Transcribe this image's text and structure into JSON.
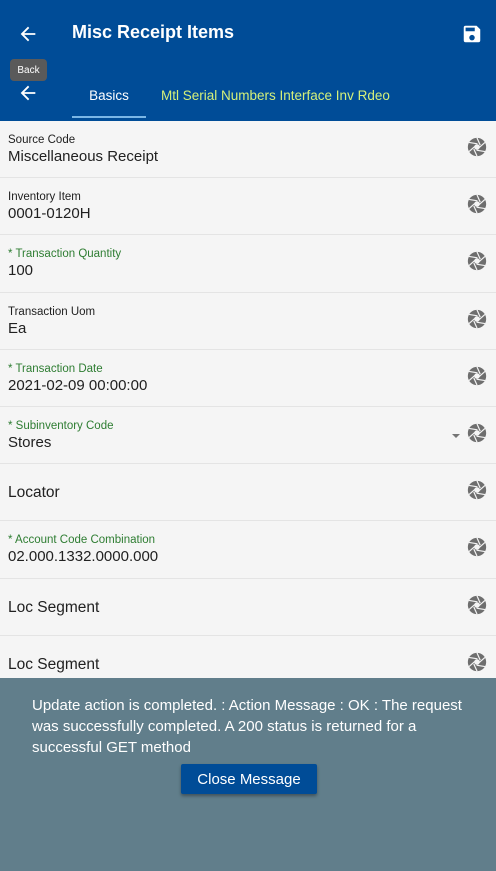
{
  "header": {
    "title": "Misc Receipt Items",
    "back_tooltip": "Back",
    "back_icon": "arrow-left",
    "save_icon": "floppy-disk"
  },
  "tabs": [
    {
      "label": "Basics",
      "active": true
    },
    {
      "label": "Mtl Serial Numbers Interface Inv Rdeo",
      "active": false
    }
  ],
  "fields": [
    {
      "label": "Source Code",
      "value": "Miscellaneous Receipt",
      "required": false
    },
    {
      "label": "Inventory Item",
      "value": "0001-0120H",
      "required": false
    },
    {
      "label": "* Transaction Quantity",
      "value": "100",
      "required": true
    },
    {
      "label": "Transaction Uom",
      "value": "Ea",
      "required": false
    },
    {
      "label": "* Transaction Date",
      "value": "2021-02-09 00:00:00",
      "required": true
    },
    {
      "label": "* Subinventory Code",
      "value": "Stores",
      "required": true,
      "dropdown": true
    },
    {
      "label": "",
      "value": "Locator",
      "required": false
    },
    {
      "label": "* Account Code Combination",
      "value": "02.000.1332.0000.000",
      "required": true
    },
    {
      "label": "",
      "value": "Loc Segment",
      "required": false
    },
    {
      "label": "",
      "value": "Loc Segment",
      "required": false
    }
  ],
  "message": {
    "text": "Update action is completed.  : Action Message : OK : The request was successfully completed. A 200 status is returned for a successful GET method",
    "close_label": "Close Message"
  },
  "colors": {
    "primary": "#004c97",
    "tab_inactive": "#d4f07a",
    "required_label": "#2e7d32",
    "overlay": "#617e8b"
  }
}
